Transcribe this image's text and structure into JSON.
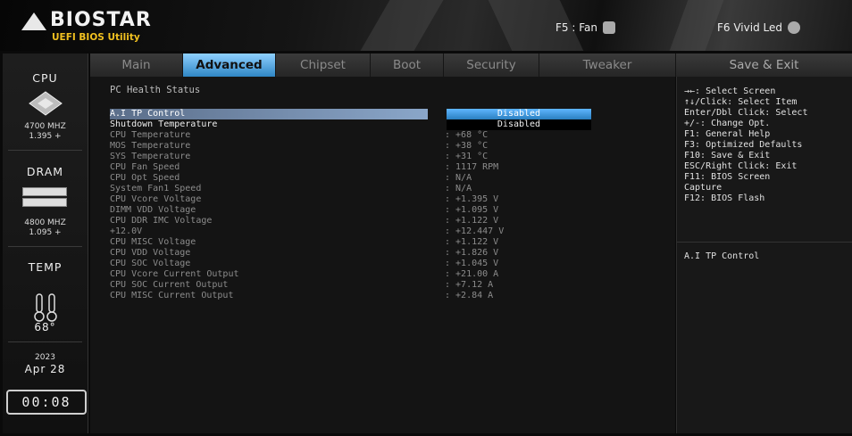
{
  "header": {
    "brand": "BIOSTAR",
    "subtitle": "UEFI BIOS Utility",
    "hotkey_f5": "F5 : Fan",
    "hotkey_f6": "F6  Vivid Led"
  },
  "sidebar": {
    "cpu_title": "CPU",
    "cpu_freq": "4700 MHZ",
    "cpu_volt": "1.395 +",
    "dram_title": "DRAM",
    "dram_freq": "4800 MHZ",
    "dram_volt": "1.095 +",
    "temp_title": "TEMP",
    "temp_value": "68°",
    "date_year": "2023",
    "date_day": "Apr  28",
    "time": "00:08"
  },
  "tabs": [
    {
      "label": "Main"
    },
    {
      "label": "Advanced"
    },
    {
      "label": "Chipset"
    },
    {
      "label": "Boot"
    },
    {
      "label": "Security"
    },
    {
      "label": "Tweaker"
    },
    {
      "label": "Save & Exit"
    }
  ],
  "main": {
    "section_title": "PC Health Status",
    "rows": [
      {
        "label": "A.I TP Control",
        "value": "Disabled"
      },
      {
        "label": "Shutdown Temperature",
        "value": "Disabled"
      },
      {
        "label": "CPU Temperature",
        "value": ": +68  °C"
      },
      {
        "label": "MOS Temperature",
        "value": ": +38  °C"
      },
      {
        "label": "SYS Temperature",
        "value": ": +31  °C"
      },
      {
        "label": "CPU Fan Speed",
        "value": ": 1117 RPM"
      },
      {
        "label": "CPU Opt Speed",
        "value": ": N/A"
      },
      {
        "label": "System Fan1 Speed",
        "value": ": N/A"
      },
      {
        "label": "CPU Vcore Voltage",
        "value": ": +1.395 V"
      },
      {
        "label": "DIMM VDD Voltage",
        "value": ": +1.095 V"
      },
      {
        "label": "CPU DDR IMC Voltage",
        "value": ": +1.122 V"
      },
      {
        "label": "+12.0V",
        "value": ": +12.447 V"
      },
      {
        "label": "CPU MISC Voltage",
        "value": ": +1.122 V"
      },
      {
        "label": "CPU VDD Voltage",
        "value": ": +1.826 V"
      },
      {
        "label": "CPU SOC Voltage",
        "value": ": +1.045 V"
      },
      {
        "label": "CPU Vcore Current Output",
        "value": ": +21.00 A"
      },
      {
        "label": "CPU SOC Current Output",
        "value": ": +7.12 A"
      },
      {
        "label": "CPU MISC Current Output",
        "value": ": +2.84 A"
      }
    ]
  },
  "help": {
    "lines": [
      "→←: Select Screen",
      "↑↓/Click: Select Item",
      "Enter/Dbl Click: Select",
      "+/-: Change Opt.",
      "F1: General Help",
      "F3: Optimized Defaults",
      "F10: Save & Exit",
      "ESC/Right Click: Exit",
      "F11: BIOS Screen",
      "Capture",
      "F12: BIOS Flash"
    ],
    "description": "A.I TP Control"
  },
  "colors": {
    "accent": "#2f86c4",
    "logo_sub": "#f0c020"
  }
}
